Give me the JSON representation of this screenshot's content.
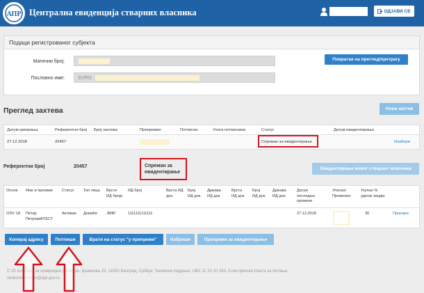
{
  "header": {
    "title": "Централна евиденција стварних власника",
    "logo_text": "АПР",
    "logout_label": "ОДЈАВИ СЕ"
  },
  "subject_panel": {
    "title": "Подаци регистрованог субјекта",
    "id_label": "Матични број:",
    "name_label": "Пословно име:",
    "name_prefix": "EURO",
    "back_button": "Повратак на преглед/претрагу"
  },
  "requests": {
    "title": "Преглед захтева",
    "new_button": "Нови захтев",
    "columns": [
      "Датум креирања",
      "Референтни број",
      "Број захтева",
      "Припремио",
      "Потписао",
      "Улога потписника",
      "Статус",
      "Датум евидентирања"
    ],
    "rows": [
      {
        "date": "27.12.2018",
        "ref": "20457",
        "status": "Спреман за евидентирање",
        "action": "Изабери"
      }
    ]
  },
  "detail": {
    "ref_label": "Референтни број",
    "ref_value": "20457",
    "status_line1": "Спреман за",
    "status_line2": "евидентирање",
    "record_button": "Евидентирање новог стварног власника"
  },
  "owners": {
    "columns": [
      "Основ",
      "Име и презиме",
      "Статус",
      "Тип лица",
      "Врста ИД броја",
      "ИД број",
      "Врста ИД док.",
      "Број ИД док.",
      "Држава ИД док.",
      "Врста ИД док.",
      "Број ИД док.",
      "Држава ИД док.",
      "Датум последње промене",
      "Уписао/ Променио",
      "Укупан % удела/ акција"
    ],
    "rows": [
      {
        "basis": "OSV 1A",
        "name": "Петар ПетровићТЕСТ",
        "status": "Активан",
        "type": "Домаће",
        "id_type": "ЈМБГ",
        "id_number": "1111111111111",
        "date": "27.12.2018",
        "share": "30",
        "action": "Прикажи"
      }
    ]
  },
  "actions": {
    "copy_address": "Копирај адресу",
    "sign": "Потпиши",
    "return_status": "Врати на статус \"у припреми\"",
    "delete": "Избриши",
    "prepare": "Припреми за евидентирање"
  },
  "footer": {
    "line1": "© 20   Агенција за привредне регистре, Бранкова 25, 11000 Београд, Србија; Техничка подршка +381 11 20 20 293. Електронска пошта за питања:",
    "line2": "stvarnivlasnistvo@apr.gov.rs"
  },
  "colors": {
    "header_bg": "#1f63a6",
    "primary_button": "#2f80c9",
    "light_button": "#8bbfe6",
    "highlight": "#d5121b"
  }
}
